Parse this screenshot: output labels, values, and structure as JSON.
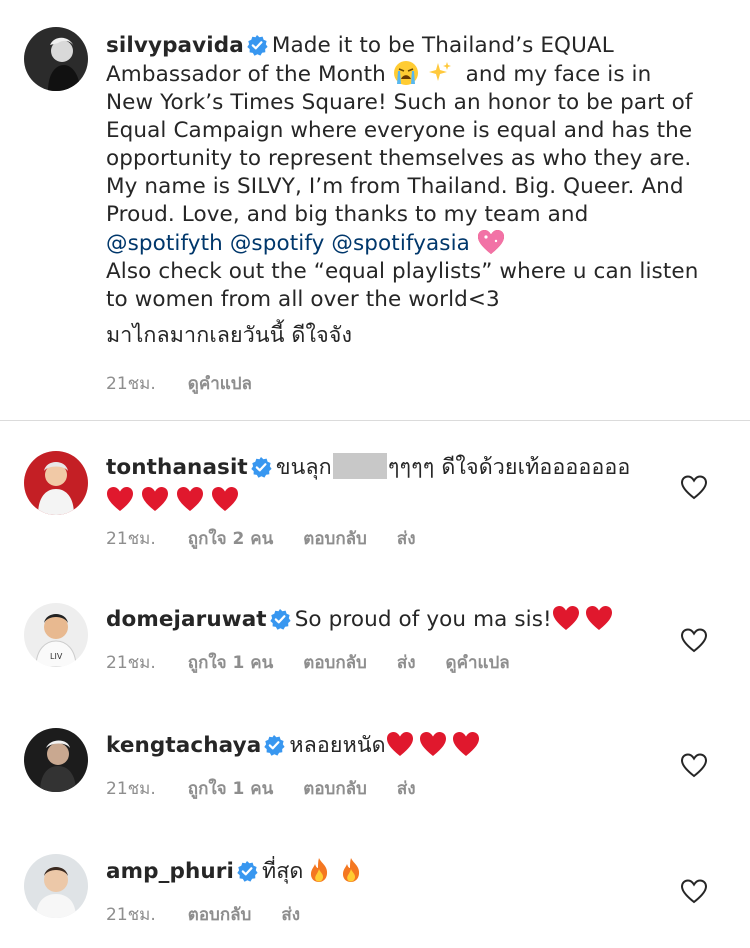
{
  "caption": {
    "username": "silvypavida",
    "line1": "Made it to be Thailand’s EQUAL",
    "line2": "Ambassador of the Month",
    "line2b": "and my face is in",
    "line3": "New York’s Times Square! Such an honor to be part of",
    "line4": "Equal Campaign where everyone is equal and has the",
    "line5": "opportunity to represent themselves as who they are.",
    "line6": "My name is SILVY, I’m from Thailand. Big. Queer. And",
    "line7": "Proud. Love, and big thanks to my team and",
    "mentions": [
      "@spotifyth",
      "@spotify",
      "@spotifyasia"
    ],
    "line9": "Also check out the “equal playlists” where u can listen",
    "line10": "to women from all over the world<3",
    "line11": "มาไกลมากเลยวันนี้ ดีใจจัง",
    "time": "21ชม.",
    "translate": "ดูคำแปล"
  },
  "comments": [
    {
      "username": "tonthanasit",
      "text_a": "ขนลุก",
      "text_b": "ๆๆๆๆ ดีใจด้วยเท้อออออออ",
      "time": "21ชม.",
      "likes": "ถูกใจ 2 คน",
      "reply": "ตอบกลับ",
      "send": "ส่ง"
    },
    {
      "username": "domejaruwat",
      "text": "So proud of you ma sis!",
      "time": "21ชม.",
      "likes": "ถูกใจ 1 คน",
      "reply": "ตอบกลับ",
      "send": "ส่ง",
      "translate": "ดูคำแปล"
    },
    {
      "username": "kengtachaya",
      "text": "หลอยหนัด",
      "time": "21ชม.",
      "likes": "ถูกใจ 1 คน",
      "reply": "ตอบกลับ",
      "send": "ส่ง"
    },
    {
      "username": "amp_phuri",
      "text": "ที่สุด",
      "time": "21ชม.",
      "reply": "ตอบกลับ",
      "send": "ส่ง"
    }
  ],
  "colors": {
    "verified": "#3897f0",
    "heart": "#e0182d",
    "mention": "#00376b",
    "meta": "#8e8e8e"
  },
  "icons": [
    "verified-badge-icon",
    "crying-face-emoji",
    "sparkles-emoji",
    "sparkling-heart-emoji",
    "red-heart-emoji",
    "fire-emoji",
    "heart-outline-icon"
  ]
}
